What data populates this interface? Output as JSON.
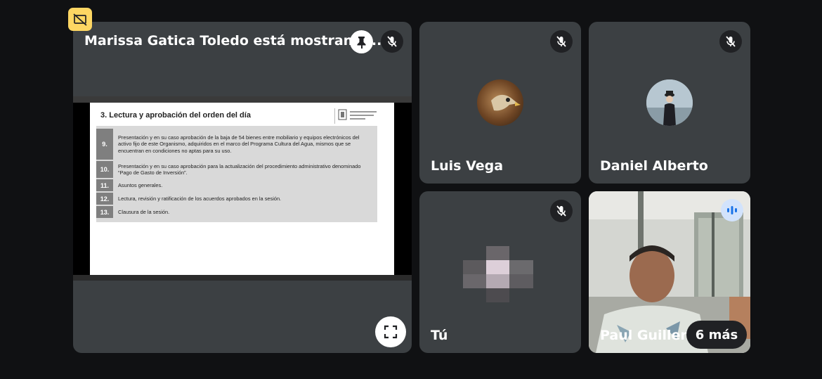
{
  "presenter": {
    "title": "Marissa Gatica Toledo está mostrando...",
    "slide": {
      "title": "3. Lectura y aprobación del orden del día",
      "items": [
        {
          "num": "9.",
          "text": "Presentación y en su caso aprobación de la baja de 54 bienes entre mobiliario y equipos electrónicos del activo fijo de este Organismo, adquiridos en el marco del Programa Cultura del Agua, mismos que se encuentran en condiciones no aptas para su uso."
        },
        {
          "num": "10.",
          "text": "Presentación y en su caso aprobación para la actualización del procedimiento administrativo denominado “Pago de Gasto de Inversión”."
        },
        {
          "num": "11.",
          "text": "Asuntos generales."
        },
        {
          "num": "12.",
          "text": "Lectura, revisión y ratificación de los acuerdos aprobados en la sesión."
        },
        {
          "num": "13.",
          "text": "Clausura de la sesión."
        }
      ]
    }
  },
  "participants": {
    "luis": {
      "name": "Luis Vega"
    },
    "daniel": {
      "name": "Daniel Alberto"
    },
    "you": {
      "name": "Tú"
    },
    "paul": {
      "name": "Paul Guillermo",
      "more_label": "6 más"
    }
  },
  "icons": {
    "present": "present-to-all-off-icon",
    "pin": "pin-icon",
    "mic_off": "mic-off-icon",
    "fullscreen": "fullscreen-icon",
    "speaking": "audio-wave-icon"
  },
  "colors": {
    "background": "#101113",
    "tile": "#3c4043",
    "present_badge": "#fdd663",
    "speaking": "#d2e3fc"
  }
}
